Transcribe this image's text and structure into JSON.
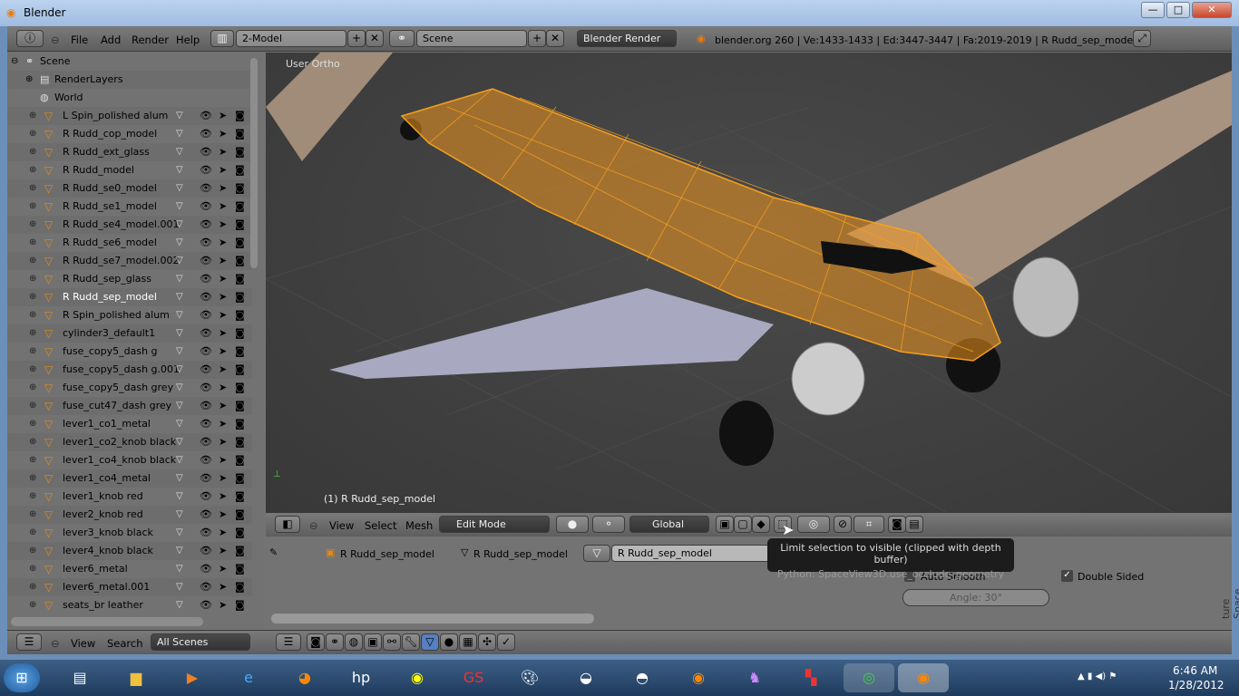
{
  "window": {
    "title": "Blender",
    "minimize": "—",
    "maximize": "□",
    "close": "✕"
  },
  "topbar": {
    "menus": [
      "File",
      "Add",
      "Render",
      "Help"
    ],
    "screen_layout": "2-Model",
    "scene": "Scene",
    "render_engine": "Blender Render",
    "stats": "blender.org 260 | Ve:1433-1433 | Ed:3447-3447 | Fa:2019-2019 | R Rudd_sep_model"
  },
  "outliner": {
    "scene": "Scene",
    "render_layers": "RenderLayers",
    "world": "World",
    "objects": [
      "L Spin_polished alum",
      "R Rudd_cop_model",
      "R Rudd_ext_glass",
      "R Rudd_model",
      "R Rudd_se0_model",
      "R Rudd_se1_model",
      "R Rudd_se4_model.001",
      "R Rudd_se6_model",
      "R Rudd_se7_model.002",
      "R Rudd_sep_glass",
      "R Rudd_sep_model",
      "R Spin_polished alum",
      "cylinder3_default1",
      "fuse_copy5_dash g",
      "fuse_copy5_dash g.001",
      "fuse_copy5_dash grey",
      "fuse_cut47_dash grey",
      "lever1_co1_metal",
      "lever1_co2_knob black",
      "lever1_co4_knob black",
      "lever1_co4_metal",
      "lever1_knob red",
      "lever2_knob red",
      "lever3_knob black",
      "lever4_knob black",
      "lever6_metal",
      "lever6_metal.001",
      "seats_br leather"
    ],
    "active": "R Rudd_sep_model",
    "footer": {
      "view": "View",
      "search": "Search",
      "filter": "All Scenes"
    }
  },
  "viewport": {
    "view_label": "User Ortho",
    "object_label": "(1) R Rudd_sep_model",
    "selection_color": "#f0961e"
  },
  "view3d_header": {
    "menus": [
      "View",
      "Select",
      "Mesh"
    ],
    "mode": "Edit Mode",
    "orientation": "Global"
  },
  "properties": {
    "breadcrumb": [
      "R Rudd_sep_model",
      "R Rudd_sep_model"
    ],
    "mesh_name": "R Rudd_sep_model",
    "auto_smooth": "Auto Smooth",
    "auto_smooth_checked": false,
    "double_sided": "Double Sided",
    "double_sided_checked": true,
    "angle": "Angle: 30°",
    "side_tab": "ture Space"
  },
  "tooltip": {
    "title": "Limit selection to visible (clipped with depth buffer)",
    "python": "Python: SpaceView3D.use_occlude_geometry"
  },
  "taskbar": {
    "time": "6:46 AM",
    "date": "1/28/2012"
  }
}
